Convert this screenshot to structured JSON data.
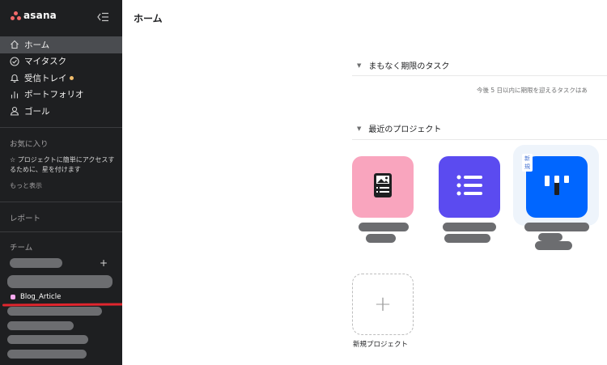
{
  "app": {
    "logo_text": "asana",
    "brand_color": "#f06a6a"
  },
  "sidebar": {
    "nav": [
      {
        "label": "ホーム",
        "icon": "home-icon",
        "active": true
      },
      {
        "label": "マイタスク",
        "icon": "check-circle-icon",
        "active": false
      },
      {
        "label": "受信トレイ",
        "icon": "bell-icon",
        "active": false,
        "notification_dot": true
      },
      {
        "label": "ポートフォリオ",
        "icon": "bar-chart-icon",
        "active": false
      },
      {
        "label": "ゴール",
        "icon": "person-icon",
        "active": false
      }
    ],
    "favorites_title": "お気に入り",
    "favorites_hint": "☆ プロジェクトに簡単にアクセスするために、星を付けます",
    "show_more": "もっと表示",
    "reports_title": "レポート",
    "teams_title": "チーム",
    "team_add": "+",
    "highlighted_project": {
      "label": "Blog_Article",
      "color": "#f9aaef"
    }
  },
  "main": {
    "page_title": "ホーム",
    "upcoming": {
      "title": "まもなく期限のタスク",
      "note": "今後 5 日以内に期限を迎えるタスクはあ"
    },
    "recent": {
      "title": "最近のプロジェクト",
      "projects": [
        {
          "color": "#f9a5be",
          "icon": "document-image-icon",
          "new": false
        },
        {
          "color": "#5b4bf0",
          "icon": "list-icon",
          "new": false
        },
        {
          "color": "#0066ff",
          "icon": "board-icon",
          "new": true,
          "badge": "新規"
        }
      ],
      "new_project_label": "新規プロジェクト",
      "new_project_symbol": "+"
    }
  }
}
